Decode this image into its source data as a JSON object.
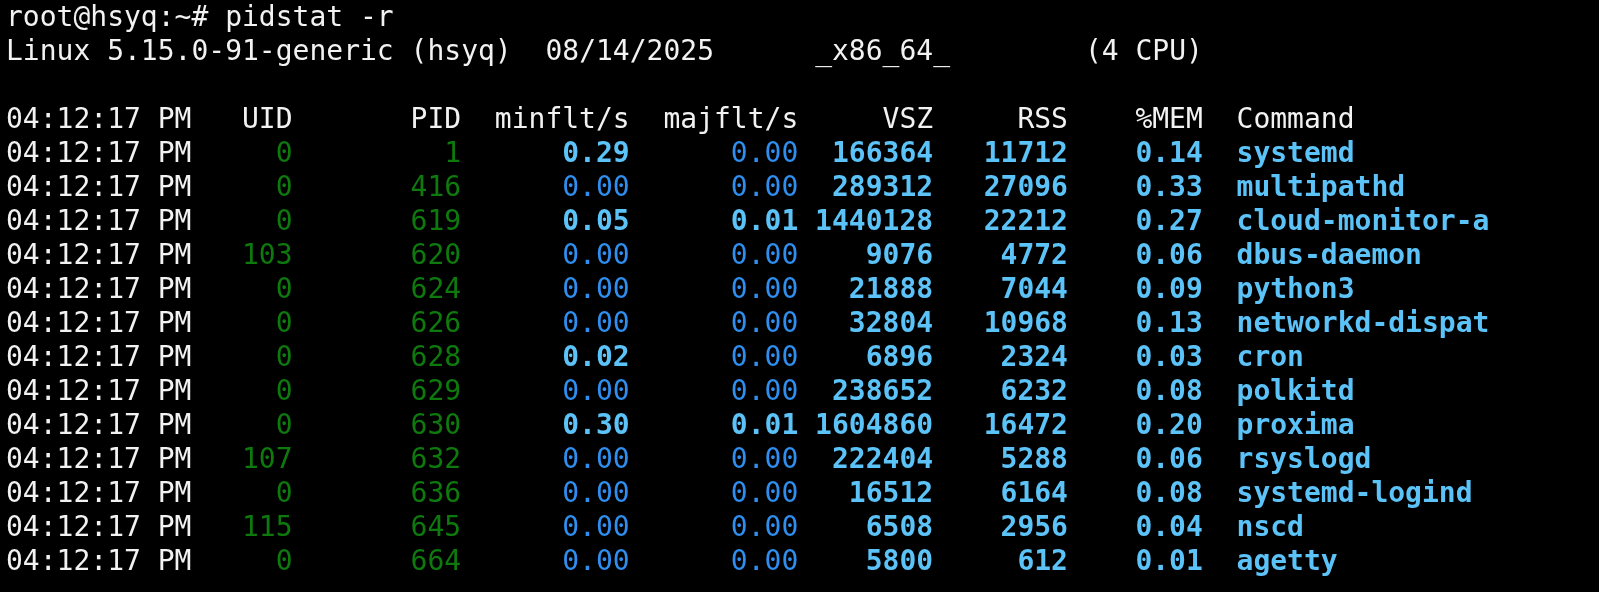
{
  "prompt": {
    "user_host": "root@hsyq:~#",
    "command": "pidstat -r"
  },
  "system_info": {
    "kernel": "Linux 5.15.0-91-generic (hsyq)",
    "date": "08/14/2025",
    "arch": "_x86_64_",
    "cpus": "(4 CPU)"
  },
  "table": {
    "columns": [
      "04:12:17 PM",
      "UID",
      "PID",
      "minflt/s",
      "majflt/s",
      "VSZ",
      "RSS",
      "%MEM",
      "Command"
    ],
    "rows": [
      {
        "time": "04:12:17 PM",
        "uid": "0",
        "pid": "1",
        "minflt": "0.29",
        "minflt_bold": true,
        "majflt": "0.00",
        "majflt_bold": false,
        "vsz": "166364",
        "rss": "11712",
        "mem": "0.14",
        "command": "systemd"
      },
      {
        "time": "04:12:17 PM",
        "uid": "0",
        "pid": "416",
        "minflt": "0.00",
        "minflt_bold": false,
        "majflt": "0.00",
        "majflt_bold": false,
        "vsz": "289312",
        "rss": "27096",
        "mem": "0.33",
        "command": "multipathd"
      },
      {
        "time": "04:12:17 PM",
        "uid": "0",
        "pid": "619",
        "minflt": "0.05",
        "minflt_bold": true,
        "majflt": "0.01",
        "majflt_bold": true,
        "vsz": "1440128",
        "rss": "22212",
        "mem": "0.27",
        "command": "cloud-monitor-a"
      },
      {
        "time": "04:12:17 PM",
        "uid": "103",
        "pid": "620",
        "minflt": "0.00",
        "minflt_bold": false,
        "majflt": "0.00",
        "majflt_bold": false,
        "vsz": "9076",
        "rss": "4772",
        "mem": "0.06",
        "command": "dbus-daemon"
      },
      {
        "time": "04:12:17 PM",
        "uid": "0",
        "pid": "624",
        "minflt": "0.00",
        "minflt_bold": false,
        "majflt": "0.00",
        "majflt_bold": false,
        "vsz": "21888",
        "rss": "7044",
        "mem": "0.09",
        "command": "python3"
      },
      {
        "time": "04:12:17 PM",
        "uid": "0",
        "pid": "626",
        "minflt": "0.00",
        "minflt_bold": false,
        "majflt": "0.00",
        "majflt_bold": false,
        "vsz": "32804",
        "rss": "10968",
        "mem": "0.13",
        "command": "networkd-dispat"
      },
      {
        "time": "04:12:17 PM",
        "uid": "0",
        "pid": "628",
        "minflt": "0.02",
        "minflt_bold": true,
        "majflt": "0.00",
        "majflt_bold": false,
        "vsz": "6896",
        "rss": "2324",
        "mem": "0.03",
        "command": "cron"
      },
      {
        "time": "04:12:17 PM",
        "uid": "0",
        "pid": "629",
        "minflt": "0.00",
        "minflt_bold": false,
        "majflt": "0.00",
        "majflt_bold": false,
        "vsz": "238652",
        "rss": "6232",
        "mem": "0.08",
        "command": "polkitd"
      },
      {
        "time": "04:12:17 PM",
        "uid": "0",
        "pid": "630",
        "minflt": "0.30",
        "minflt_bold": true,
        "majflt": "0.01",
        "majflt_bold": true,
        "vsz": "1604860",
        "rss": "16472",
        "mem": "0.20",
        "command": "proxima"
      },
      {
        "time": "04:12:17 PM",
        "uid": "107",
        "pid": "632",
        "minflt": "0.00",
        "minflt_bold": false,
        "majflt": "0.00",
        "majflt_bold": false,
        "vsz": "222404",
        "rss": "5288",
        "mem": "0.06",
        "command": "rsyslogd"
      },
      {
        "time": "04:12:17 PM",
        "uid": "0",
        "pid": "636",
        "minflt": "0.00",
        "minflt_bold": false,
        "majflt": "0.00",
        "majflt_bold": false,
        "vsz": "16512",
        "rss": "6164",
        "mem": "0.08",
        "command": "systemd-logind"
      },
      {
        "time": "04:12:17 PM",
        "uid": "115",
        "pid": "645",
        "minflt": "0.00",
        "minflt_bold": false,
        "majflt": "0.00",
        "majflt_bold": false,
        "vsz": "6508",
        "rss": "2956",
        "mem": "0.04",
        "command": "nscd"
      },
      {
        "time": "04:12:17 PM",
        "uid": "0",
        "pid": "664",
        "minflt": "0.00",
        "minflt_bold": false,
        "majflt": "0.00",
        "majflt_bold": false,
        "vsz": "5800",
        "rss": "612",
        "mem": "0.01",
        "command": "agetty"
      }
    ]
  }
}
